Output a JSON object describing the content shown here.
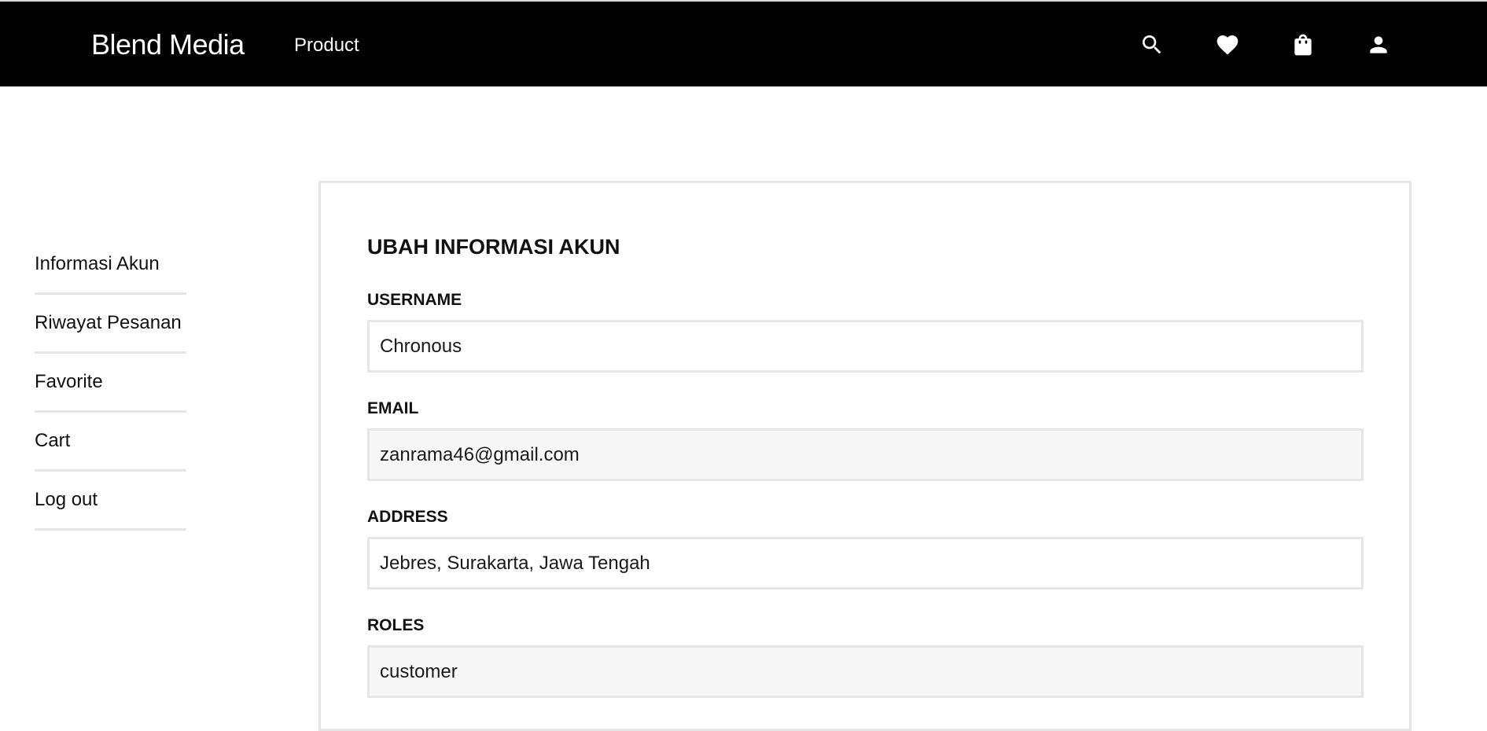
{
  "navbar": {
    "brand": "Blend Media",
    "links": [
      "Product"
    ],
    "icons": [
      "search-icon",
      "heart-icon",
      "shopping-bag-icon",
      "user-icon"
    ],
    "background": "#000000"
  },
  "sidebar": {
    "items": [
      {
        "label": "Informasi Akun"
      },
      {
        "label": "Riwayat Pesanan"
      },
      {
        "label": "Favorite"
      },
      {
        "label": "Cart"
      },
      {
        "label": "Log out"
      }
    ]
  },
  "form": {
    "title": "UBAH INFORMASI AKUN",
    "fields": [
      {
        "label": "USERNAME",
        "value": "Chronous"
      },
      {
        "label": "EMAIL",
        "value": "zanrama46@gmail.com"
      },
      {
        "label": "ADDRESS",
        "value": "Jebres, Surakarta, Jawa Tengah"
      },
      {
        "label": "ROLES",
        "value": "customer"
      }
    ]
  }
}
